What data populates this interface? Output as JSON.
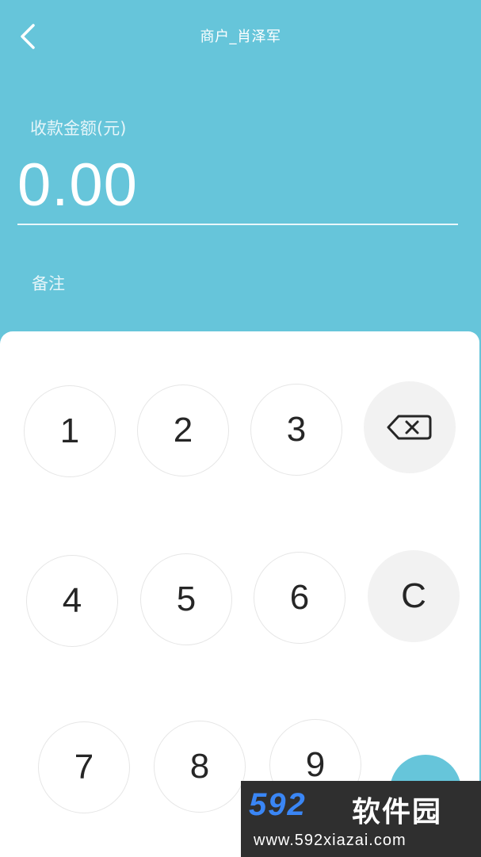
{
  "header": {
    "title": "商户_肖泽军",
    "amount_label": "收款金额(元)",
    "amount_value": "0.00",
    "note_label": "备注"
  },
  "keypad": {
    "keys": {
      "1": "1",
      "2": "2",
      "3": "3",
      "4": "4",
      "5": "5",
      "6": "6",
      "7": "7",
      "8": "8",
      "9": "9",
      "clear": "C"
    },
    "icons": {
      "back": "chevron-left-icon",
      "backspace": "backspace-icon"
    }
  },
  "watermark": {
    "logo": "592",
    "name": "软件园",
    "url": "www.592xiazai.com"
  },
  "colors": {
    "accent": "#66C5DA",
    "key_text": "#262626",
    "key_gray": "#F2F2F2"
  }
}
